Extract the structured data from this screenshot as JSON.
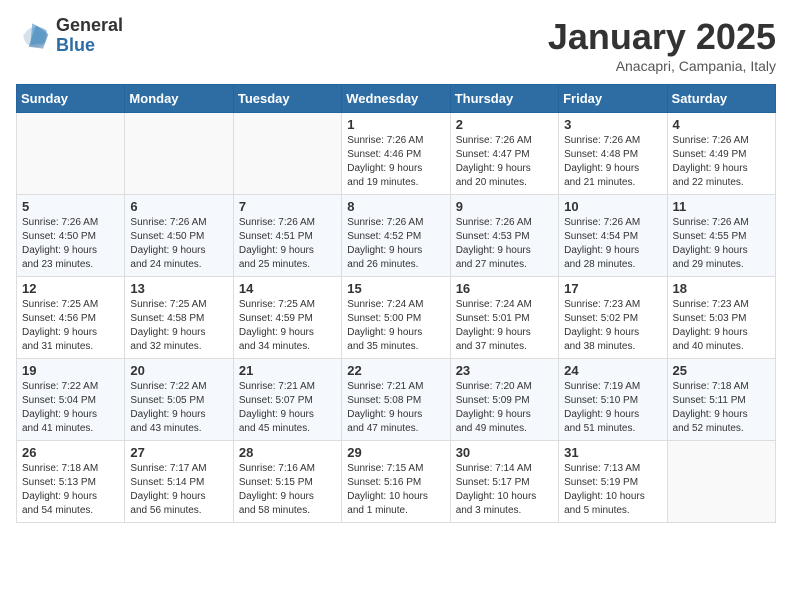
{
  "header": {
    "logo_general": "General",
    "logo_blue": "Blue",
    "month_title": "January 2025",
    "subtitle": "Anacapri, Campania, Italy"
  },
  "weekdays": [
    "Sunday",
    "Monday",
    "Tuesday",
    "Wednesday",
    "Thursday",
    "Friday",
    "Saturday"
  ],
  "weeks": [
    [
      {
        "day": "",
        "info": ""
      },
      {
        "day": "",
        "info": ""
      },
      {
        "day": "",
        "info": ""
      },
      {
        "day": "1",
        "info": "Sunrise: 7:26 AM\nSunset: 4:46 PM\nDaylight: 9 hours\nand 19 minutes."
      },
      {
        "day": "2",
        "info": "Sunrise: 7:26 AM\nSunset: 4:47 PM\nDaylight: 9 hours\nand 20 minutes."
      },
      {
        "day": "3",
        "info": "Sunrise: 7:26 AM\nSunset: 4:48 PM\nDaylight: 9 hours\nand 21 minutes."
      },
      {
        "day": "4",
        "info": "Sunrise: 7:26 AM\nSunset: 4:49 PM\nDaylight: 9 hours\nand 22 minutes."
      }
    ],
    [
      {
        "day": "5",
        "info": "Sunrise: 7:26 AM\nSunset: 4:50 PM\nDaylight: 9 hours\nand 23 minutes."
      },
      {
        "day": "6",
        "info": "Sunrise: 7:26 AM\nSunset: 4:50 PM\nDaylight: 9 hours\nand 24 minutes."
      },
      {
        "day": "7",
        "info": "Sunrise: 7:26 AM\nSunset: 4:51 PM\nDaylight: 9 hours\nand 25 minutes."
      },
      {
        "day": "8",
        "info": "Sunrise: 7:26 AM\nSunset: 4:52 PM\nDaylight: 9 hours\nand 26 minutes."
      },
      {
        "day": "9",
        "info": "Sunrise: 7:26 AM\nSunset: 4:53 PM\nDaylight: 9 hours\nand 27 minutes."
      },
      {
        "day": "10",
        "info": "Sunrise: 7:26 AM\nSunset: 4:54 PM\nDaylight: 9 hours\nand 28 minutes."
      },
      {
        "day": "11",
        "info": "Sunrise: 7:26 AM\nSunset: 4:55 PM\nDaylight: 9 hours\nand 29 minutes."
      }
    ],
    [
      {
        "day": "12",
        "info": "Sunrise: 7:25 AM\nSunset: 4:56 PM\nDaylight: 9 hours\nand 31 minutes."
      },
      {
        "day": "13",
        "info": "Sunrise: 7:25 AM\nSunset: 4:58 PM\nDaylight: 9 hours\nand 32 minutes."
      },
      {
        "day": "14",
        "info": "Sunrise: 7:25 AM\nSunset: 4:59 PM\nDaylight: 9 hours\nand 34 minutes."
      },
      {
        "day": "15",
        "info": "Sunrise: 7:24 AM\nSunset: 5:00 PM\nDaylight: 9 hours\nand 35 minutes."
      },
      {
        "day": "16",
        "info": "Sunrise: 7:24 AM\nSunset: 5:01 PM\nDaylight: 9 hours\nand 37 minutes."
      },
      {
        "day": "17",
        "info": "Sunrise: 7:23 AM\nSunset: 5:02 PM\nDaylight: 9 hours\nand 38 minutes."
      },
      {
        "day": "18",
        "info": "Sunrise: 7:23 AM\nSunset: 5:03 PM\nDaylight: 9 hours\nand 40 minutes."
      }
    ],
    [
      {
        "day": "19",
        "info": "Sunrise: 7:22 AM\nSunset: 5:04 PM\nDaylight: 9 hours\nand 41 minutes."
      },
      {
        "day": "20",
        "info": "Sunrise: 7:22 AM\nSunset: 5:05 PM\nDaylight: 9 hours\nand 43 minutes."
      },
      {
        "day": "21",
        "info": "Sunrise: 7:21 AM\nSunset: 5:07 PM\nDaylight: 9 hours\nand 45 minutes."
      },
      {
        "day": "22",
        "info": "Sunrise: 7:21 AM\nSunset: 5:08 PM\nDaylight: 9 hours\nand 47 minutes."
      },
      {
        "day": "23",
        "info": "Sunrise: 7:20 AM\nSunset: 5:09 PM\nDaylight: 9 hours\nand 49 minutes."
      },
      {
        "day": "24",
        "info": "Sunrise: 7:19 AM\nSunset: 5:10 PM\nDaylight: 9 hours\nand 51 minutes."
      },
      {
        "day": "25",
        "info": "Sunrise: 7:18 AM\nSunset: 5:11 PM\nDaylight: 9 hours\nand 52 minutes."
      }
    ],
    [
      {
        "day": "26",
        "info": "Sunrise: 7:18 AM\nSunset: 5:13 PM\nDaylight: 9 hours\nand 54 minutes."
      },
      {
        "day": "27",
        "info": "Sunrise: 7:17 AM\nSunset: 5:14 PM\nDaylight: 9 hours\nand 56 minutes."
      },
      {
        "day": "28",
        "info": "Sunrise: 7:16 AM\nSunset: 5:15 PM\nDaylight: 9 hours\nand 58 minutes."
      },
      {
        "day": "29",
        "info": "Sunrise: 7:15 AM\nSunset: 5:16 PM\nDaylight: 10 hours\nand 1 minute."
      },
      {
        "day": "30",
        "info": "Sunrise: 7:14 AM\nSunset: 5:17 PM\nDaylight: 10 hours\nand 3 minutes."
      },
      {
        "day": "31",
        "info": "Sunrise: 7:13 AM\nSunset: 5:19 PM\nDaylight: 10 hours\nand 5 minutes."
      },
      {
        "day": "",
        "info": ""
      }
    ]
  ]
}
